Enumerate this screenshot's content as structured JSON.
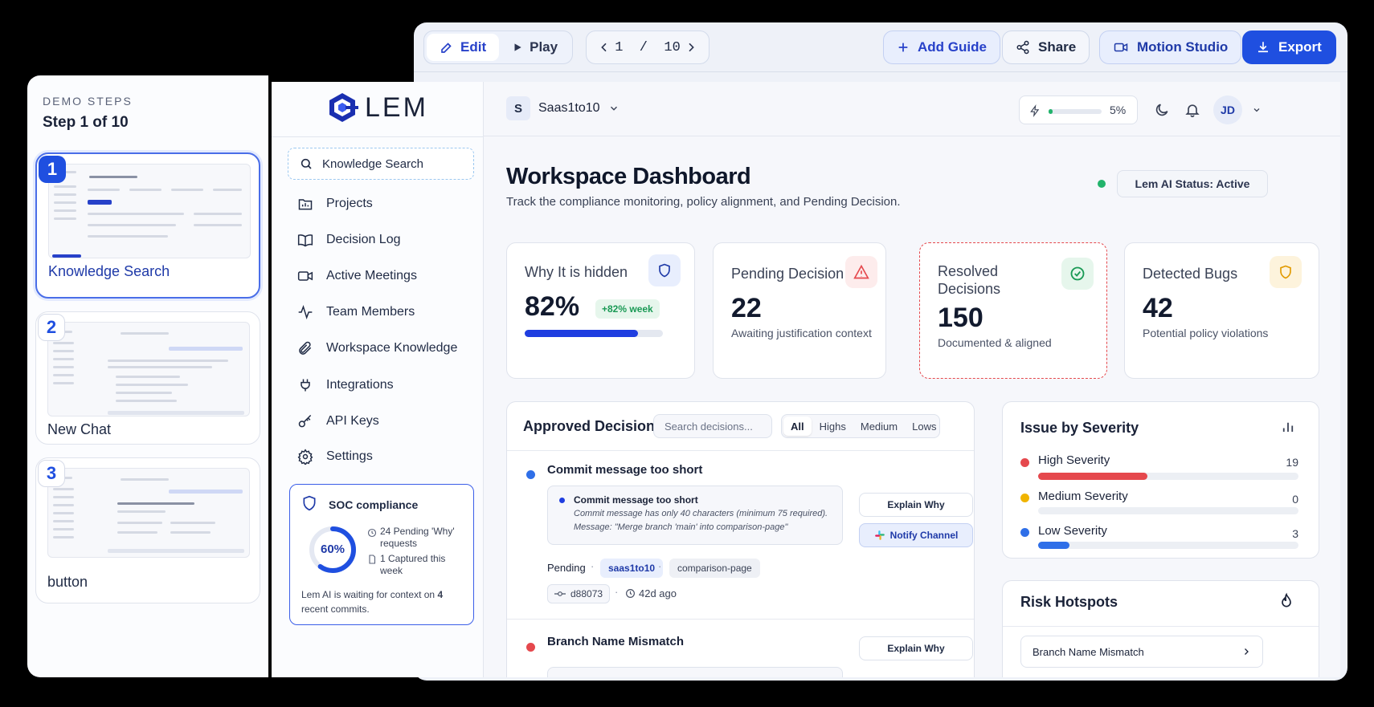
{
  "editor": {
    "edit_label": "Edit",
    "play_label": "Play",
    "page_indicator": "1  /  10",
    "add_guide_label": "Add Guide",
    "share_label": "Share",
    "motion_studio_label": "Motion Studio",
    "export_label": "Export"
  },
  "demo_steps": {
    "heading": "DEMO STEPS",
    "subheading": "Step 1 of 10",
    "steps": [
      {
        "number": "1",
        "label": "Knowledge Search"
      },
      {
        "number": "2",
        "label": "New Chat"
      },
      {
        "number": "3",
        "label": "button"
      }
    ]
  },
  "sidebar": {
    "logo_text": "LEM",
    "search_label": "Knowledge Search",
    "items": [
      {
        "label": "Projects",
        "icon": "folder-chart-icon"
      },
      {
        "label": "Decision Log",
        "icon": "book-icon"
      },
      {
        "label": "Active Meetings",
        "icon": "video-icon"
      },
      {
        "label": "Team Members",
        "icon": "pulse-icon"
      },
      {
        "label": "Workspace Knowledge",
        "icon": "paperclip-icon"
      },
      {
        "label": "Integrations",
        "icon": "plug-icon"
      },
      {
        "label": "API Keys",
        "icon": "key-icon"
      },
      {
        "label": "Settings",
        "icon": "gear-icon"
      }
    ],
    "compliance": {
      "title": "SOC compliance",
      "percent_label": "60%",
      "percent_value": 0.6,
      "pending_line_1": "24 Pending 'Why'",
      "pending_line_2": "requests",
      "captured_line_1": "1 Captured this",
      "captured_line_2": "week",
      "footer_prefix": "Lem AI is waiting for context on",
      "footer_count": "4",
      "footer_suffix": "recent commits."
    }
  },
  "header": {
    "workspace_initial": "S",
    "workspace_name": "Saas1to10",
    "usage_percent_label": "5%",
    "usage_value": 0.05,
    "avatar_initials": "JD"
  },
  "dashboard": {
    "title": "Workspace Dashboard",
    "subtitle": "Track the compliance monitoring, policy alignment, and Pending Decision.",
    "status_label": "Lem AI Status: Active",
    "kpis": [
      {
        "title": "Why It is hidden",
        "value": "82%",
        "badge": "+82% week",
        "progress": 0.82
      },
      {
        "title": "Pending Decision",
        "value": "22",
        "subtitle": "Awaiting justification context"
      },
      {
        "title_line_1": "Resolved",
        "title_line_2": "Decisions",
        "value": "150",
        "subtitle": "Documented & aligned"
      },
      {
        "title": "Detected Bugs",
        "value": "42",
        "subtitle": "Potential policy violations"
      }
    ],
    "approved": {
      "title": "Approved Decision",
      "search_placeholder": "Search decisions...",
      "filters": [
        "All",
        "Highs",
        "Medium",
        "Lows"
      ],
      "items": [
        {
          "title": "Commit message too short",
          "detail_title": "Commit message too short",
          "detail_line_1": "Commit message has only 40 characters (minimum 75 required).",
          "detail_line_2": "Message: \"Merge branch 'main' into comparison-page\"",
          "explain_label": "Explain Why",
          "notify_label": "Notify Channel",
          "status": "Pending",
          "repo": "saas1to10",
          "branch": "comparison-page",
          "commit": "d88073",
          "age": "42d ago"
        },
        {
          "title": "Branch Name Mismatch",
          "explain_label": "Explain Why"
        }
      ]
    },
    "severity": {
      "title": "Issue by Severity",
      "items": [
        {
          "label": "High Severity",
          "count": "19",
          "color": "#e5484d",
          "fill": 0.42
        },
        {
          "label": "Medium Severity",
          "count": "0",
          "color": "#f0b400",
          "fill": 0.0
        },
        {
          "label": "Low Severity",
          "count": "3",
          "color": "#2f6fe8",
          "fill": 0.12
        }
      ]
    },
    "hotspots": {
      "title": "Risk Hotspots",
      "items": [
        "Branch Name Mismatch"
      ]
    }
  }
}
